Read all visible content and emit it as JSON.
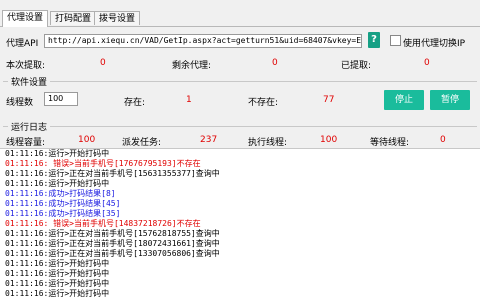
{
  "tabs": [
    "代理设置",
    "打码配置",
    "拨号设置"
  ],
  "api": {
    "label": "代理API",
    "url": "http://api.xiequ.cn/VAD/GetIp.aspx?act=getturn51&uid=68407&vkey=EDB1AA83",
    "help_label": "?",
    "checkbox_label": "使用代理切换IP",
    "checked": false
  },
  "stats_top": {
    "extracted_label": "本次提取:",
    "extracted_value": "0",
    "remaining_label": "剩余代理:",
    "remaining_value": "0",
    "already_label": "已提取:",
    "already_value": "0"
  },
  "software": {
    "title": "软件设置",
    "threads_label": "线程数",
    "threads_value": "100",
    "exists_label": "存在:",
    "exists_value": "1",
    "not_exists_label": "不存在:",
    "not_exists_value": "77",
    "stop_label": "停止",
    "pause_label": "暂停"
  },
  "runlog": {
    "title": "运行日志",
    "capacity_label": "线程容量:",
    "capacity_value": "100",
    "dispatch_label": "派发任务:",
    "dispatch_value": "237",
    "exec_label": "执行线程:",
    "exec_value": "100",
    "wait_label": "等待线程:",
    "wait_value": "0"
  },
  "log_lines": [
    {
      "text": "01:11:16:运行>开始打码中",
      "type": "normal"
    },
    {
      "text": "01:11:16: 错误>当前手机号[17676795193]不存在",
      "type": "error"
    },
    {
      "text": "01:11:16:运行>正在对当前手机号[15631355377]查询中",
      "type": "normal"
    },
    {
      "text": "01:11:16:运行>开始打码中",
      "type": "normal"
    },
    {
      "text": "01:11:16:成功>打码结果[8]",
      "type": "success"
    },
    {
      "text": "01:11:16:成功>打码结果[45]",
      "type": "success"
    },
    {
      "text": "01:11:16:成功>打码结果[35]",
      "type": "success"
    },
    {
      "text": "01:11:16: 错误>当前手机号[14837218726]不存在",
      "type": "error"
    },
    {
      "text": "01:11:16:运行>正在对当前手机号[15762818755]查询中",
      "type": "normal"
    },
    {
      "text": "01:11:16:运行>正在对当前手机号[18072431661]查询中",
      "type": "normal"
    },
    {
      "text": "01:11:16:运行>正在对当前手机号[13307056806]查询中",
      "type": "normal"
    },
    {
      "text": "01:11:16:运行>开始打码中",
      "type": "normal"
    },
    {
      "text": "01:11:16:运行>开始打码中",
      "type": "normal"
    },
    {
      "text": "01:11:16:运行>开始打码中",
      "type": "normal"
    },
    {
      "text": "01:11:16:运行>开始打码中",
      "type": "normal"
    }
  ],
  "colors": {
    "accent": "#1abc9c",
    "error": "#e00000",
    "success": "#1a1ae0"
  }
}
